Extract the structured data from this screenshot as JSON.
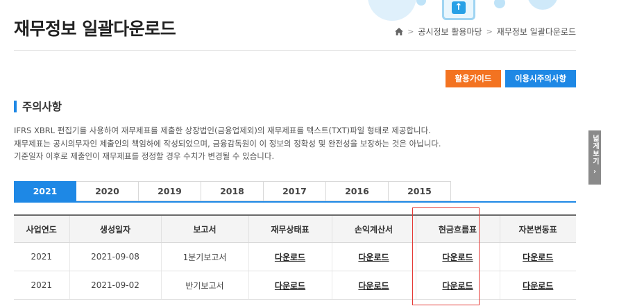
{
  "header": {
    "title": "재무정보 일괄다운로드",
    "breadcrumb": [
      "공시정보 활용마당",
      "재무정보 일괄다운로드"
    ]
  },
  "buttons": {
    "guide": "활용가이드",
    "notice": "이용시주의사항"
  },
  "section": {
    "title": "주의사항",
    "lines": [
      "IFRS XBRL 편집기를 사용하여 재무제표를 제출한 상장법인(금융업제외)의 재무제표를 텍스트(TXT)파일 형태로 제공합니다.",
      "재무제표는 공시의무자인 제출인의 책임하에 작성되었으며, 금융감독원이 이 정보의 정확성 및 완전성을 보장하는 것은 아닙니다.",
      "기준일자 이후로 제출인이 재무제표를 정정할 경우 수치가 변경될 수 있습니다."
    ]
  },
  "side_tab": {
    "label": "넓게보기",
    "chevron": "›"
  },
  "year_tabs": [
    "2021",
    "2020",
    "2019",
    "2018",
    "2017",
    "2016",
    "2015"
  ],
  "active_year": "2021",
  "table": {
    "headers": [
      "사업연도",
      "생성일자",
      "보고서",
      "재무상태표",
      "손익계산서",
      "현금흐름표",
      "자본변동표"
    ],
    "rows": [
      [
        "2021",
        "2021-09-08",
        "1분기보고서",
        "다운로드",
        "다운로드",
        "다운로드",
        "다운로드"
      ],
      [
        "2021",
        "2021-09-02",
        "반기보고서",
        "다운로드",
        "다운로드",
        "다운로드",
        "다운로드"
      ]
    ]
  },
  "colors": {
    "accent": "#1e88e5",
    "guide_button": "#f37321",
    "highlight": "#e53935"
  },
  "icons": {
    "home": "home-icon",
    "upload": "upload-arrow-icon"
  }
}
